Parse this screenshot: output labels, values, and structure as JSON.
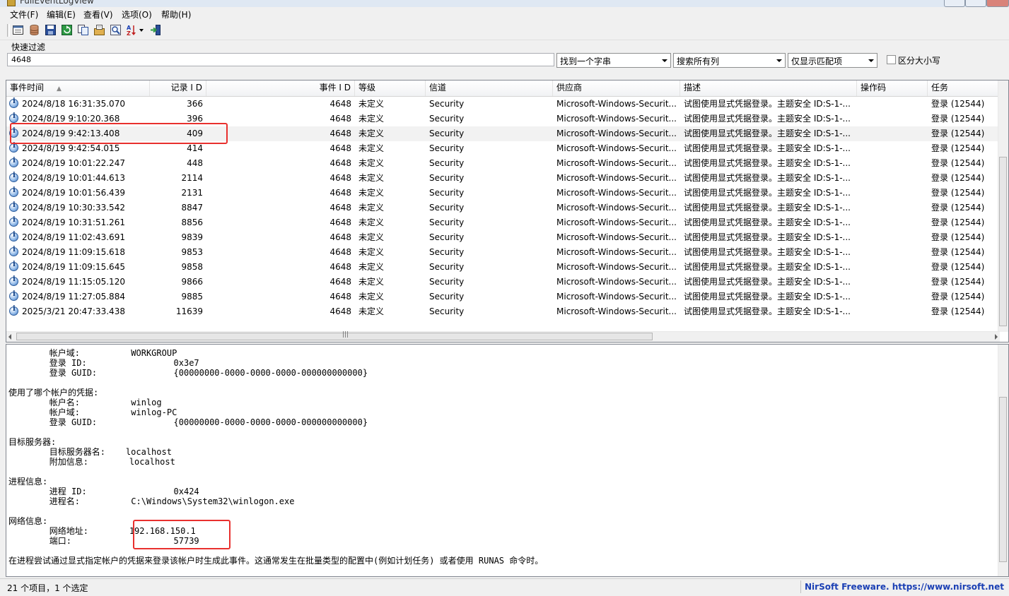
{
  "window": {
    "title": "FullEventLogView"
  },
  "menu": [
    "文件(F)",
    "编辑(E)",
    "查看(V)",
    "选项(O)",
    "帮助(H)"
  ],
  "toolbar": {
    "icons": [
      "properties-icon",
      "database-icon",
      "save-icon",
      "refresh-icon",
      "copy-icon",
      "options-icon",
      "find-icon",
      "sort-icon",
      "exit-icon"
    ]
  },
  "filter": {
    "label": "快速过滤",
    "value": "4648",
    "match_mode": "找到一个字串",
    "search_columns": "搜索所有列",
    "show_mode": "仅显示匹配项",
    "case_label": "区分大小写"
  },
  "columns": [
    "事件时间",
    "记录 I D",
    "事件 I D",
    "等级",
    "信道",
    "供应商",
    "描述",
    "操作码",
    "任务"
  ],
  "rows": [
    {
      "time": "2024/8/18 16:31:35.070",
      "record": "366",
      "event": "4648",
      "level": "未定义",
      "channel": "Security",
      "provider": "Microsoft-Windows-Securit...",
      "desc": "试图使用显式凭据登录。主题安全 ID:S-1-...",
      "opcode": "",
      "task": "登录 (12544)"
    },
    {
      "time": "2024/8/19 9:10:20.368",
      "record": "396",
      "event": "4648",
      "level": "未定义",
      "channel": "Security",
      "provider": "Microsoft-Windows-Securit...",
      "desc": "试图使用显式凭据登录。主题安全 ID:S-1-...",
      "opcode": "",
      "task": "登录 (12544)"
    },
    {
      "time": "2024/8/19 9:42:13.408",
      "record": "409",
      "event": "4648",
      "level": "未定义",
      "channel": "Security",
      "provider": "Microsoft-Windows-Securit...",
      "desc": "试图使用显式凭据登录。主题安全 ID:S-1-...",
      "opcode": "",
      "task": "登录 (12544)"
    },
    {
      "time": "2024/8/19 9:42:54.015",
      "record": "414",
      "event": "4648",
      "level": "未定义",
      "channel": "Security",
      "provider": "Microsoft-Windows-Securit...",
      "desc": "试图使用显式凭据登录。主题安全 ID:S-1-...",
      "opcode": "",
      "task": "登录 (12544)"
    },
    {
      "time": "2024/8/19 10:01:22.247",
      "record": "448",
      "event": "4648",
      "level": "未定义",
      "channel": "Security",
      "provider": "Microsoft-Windows-Securit...",
      "desc": "试图使用显式凭据登录。主题安全 ID:S-1-...",
      "opcode": "",
      "task": "登录 (12544)"
    },
    {
      "time": "2024/8/19 10:01:44.613",
      "record": "2114",
      "event": "4648",
      "level": "未定义",
      "channel": "Security",
      "provider": "Microsoft-Windows-Securit...",
      "desc": "试图使用显式凭据登录。主题安全 ID:S-1-...",
      "opcode": "",
      "task": "登录 (12544)"
    },
    {
      "time": "2024/8/19 10:01:56.439",
      "record": "2131",
      "event": "4648",
      "level": "未定义",
      "channel": "Security",
      "provider": "Microsoft-Windows-Securit...",
      "desc": "试图使用显式凭据登录。主题安全 ID:S-1-...",
      "opcode": "",
      "task": "登录 (12544)"
    },
    {
      "time": "2024/8/19 10:30:33.542",
      "record": "8847",
      "event": "4648",
      "level": "未定义",
      "channel": "Security",
      "provider": "Microsoft-Windows-Securit...",
      "desc": "试图使用显式凭据登录。主题安全 ID:S-1-...",
      "opcode": "",
      "task": "登录 (12544)"
    },
    {
      "time": "2024/8/19 10:31:51.261",
      "record": "8856",
      "event": "4648",
      "level": "未定义",
      "channel": "Security",
      "provider": "Microsoft-Windows-Securit...",
      "desc": "试图使用显式凭据登录。主题安全 ID:S-1-...",
      "opcode": "",
      "task": "登录 (12544)"
    },
    {
      "time": "2024/8/19 11:02:43.691",
      "record": "9839",
      "event": "4648",
      "level": "未定义",
      "channel": "Security",
      "provider": "Microsoft-Windows-Securit...",
      "desc": "试图使用显式凭据登录。主题安全 ID:S-1-...",
      "opcode": "",
      "task": "登录 (12544)"
    },
    {
      "time": "2024/8/19 11:09:15.618",
      "record": "9853",
      "event": "4648",
      "level": "未定义",
      "channel": "Security",
      "provider": "Microsoft-Windows-Securit...",
      "desc": "试图使用显式凭据登录。主题安全 ID:S-1-...",
      "opcode": "",
      "task": "登录 (12544)"
    },
    {
      "time": "2024/8/19 11:09:15.645",
      "record": "9858",
      "event": "4648",
      "level": "未定义",
      "channel": "Security",
      "provider": "Microsoft-Windows-Securit...",
      "desc": "试图使用显式凭据登录。主题安全 ID:S-1-...",
      "opcode": "",
      "task": "登录 (12544)"
    },
    {
      "time": "2024/8/19 11:15:05.120",
      "record": "9866",
      "event": "4648",
      "level": "未定义",
      "channel": "Security",
      "provider": "Microsoft-Windows-Securit...",
      "desc": "试图使用显式凭据登录。主题安全 ID:S-1-...",
      "opcode": "",
      "task": "登录 (12544)"
    },
    {
      "time": "2024/8/19 11:27:05.884",
      "record": "9885",
      "event": "4648",
      "level": "未定义",
      "channel": "Security",
      "provider": "Microsoft-Windows-Securit...",
      "desc": "试图使用显式凭据登录。主题安全 ID:S-1-...",
      "opcode": "",
      "task": "登录 (12544)"
    },
    {
      "time": "2025/3/21 20:47:33.438",
      "record": "11639",
      "event": "4648",
      "level": "未定义",
      "channel": "Security",
      "provider": "Microsoft-Windows-Securit...",
      "desc": "试图使用显式凭据登录。主题安全 ID:S-1-...",
      "opcode": "",
      "task": "登录 (12544)"
    }
  ],
  "selected_row": 2,
  "detail_lines": [
    "        帐户域:          WORKGROUP",
    "        登录 ID:                 0x3e7",
    "        登录 GUID:               {00000000-0000-0000-0000-000000000000}",
    "",
    "使用了哪个帐户的凭据:",
    "        帐户名:          winlog",
    "        帐户域:          winlog-PC",
    "        登录 GUID:               {00000000-0000-0000-0000-000000000000}",
    "",
    "目标服务器:",
    "        目标服务器名:    localhost",
    "        附加信息:        localhost",
    "",
    "进程信息:",
    "        进程 ID:                 0x424",
    "        进程名:          C:\\Windows\\System32\\winlogon.exe",
    "",
    "网络信息:",
    "        网络地址:        192.168.150.1",
    "        端口:                    57739",
    "",
    "在进程尝试通过显式指定帐户的凭据来登录该帐户时生成此事件。这通常发生在批量类型的配置中(例如计划任务) 或者使用 RUNAS 命令时。"
  ],
  "status": {
    "count": "21 个项目，1 个选定",
    "credit": "NirSoft Freeware. https://www.nirsoft.net"
  },
  "colors": {
    "highlight": "#e8302e",
    "link": "#1a3fb4"
  }
}
